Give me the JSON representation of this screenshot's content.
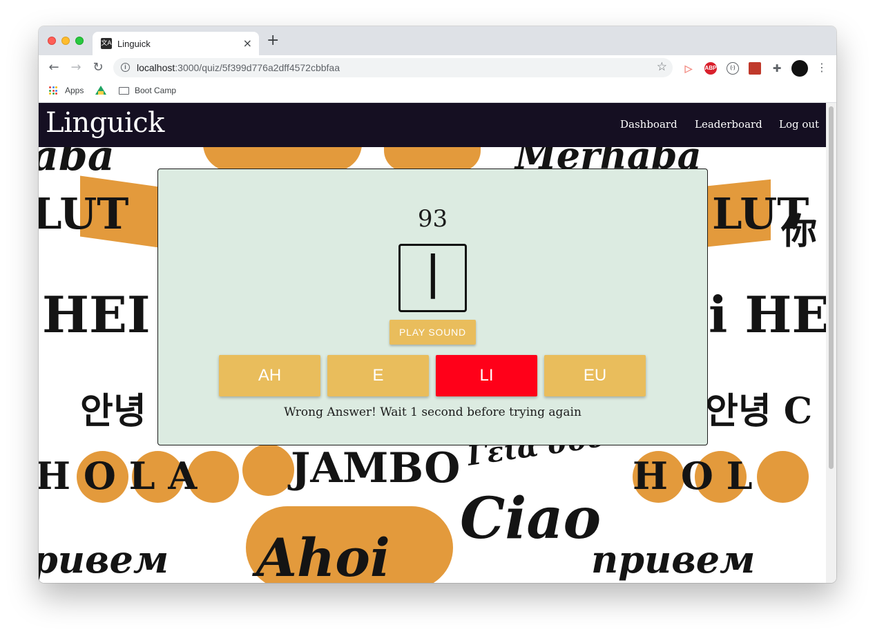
{
  "browser": {
    "tab_title": "Linguick",
    "tab_favicon": "文A",
    "new_tab_label": "+",
    "url_host": "localhost",
    "url_rest": ":3000/quiz/5f399d776a2dff4572cbbfaa",
    "bookmarks": [
      {
        "label": "Apps",
        "icon": "apps-grid-icon"
      },
      {
        "label": "",
        "icon": "google-drive-icon"
      },
      {
        "label": "Boot Camp",
        "icon": "folder-icon"
      }
    ],
    "extensions": [
      {
        "name": "cast-icon",
        "text": "",
        "color": "#f28b82"
      },
      {
        "name": "adblock-plus-icon",
        "text": "ABP",
        "color": "#d9202c"
      },
      {
        "name": "code-extension-icon",
        "text": "(·)",
        "color": "#5f6368"
      },
      {
        "name": "image-extension-icon",
        "text": "",
        "color": "#c0392b"
      },
      {
        "name": "puzzle-extensions-icon",
        "text": "",
        "color": "#5f6368"
      },
      {
        "name": "profile-avatar",
        "text": "",
        "color": "#111111"
      }
    ]
  },
  "app": {
    "brand": "Linguick",
    "nav": {
      "dashboard": "Dashboard",
      "leaderboard": "Leaderboard",
      "logout": "Log out"
    },
    "colors": {
      "navbar": "#150f22",
      "card": "#dcebe1",
      "answer": "#e9bd5c",
      "wrong": "#ff0019"
    }
  },
  "quiz": {
    "timer": "93",
    "character": "ㅣ",
    "play_sound": "PLAY SOUND",
    "answers": [
      "AH",
      "E",
      "LI",
      "EU"
    ],
    "selected_wrong_index": 2,
    "message": "Wrong Answer! Wait 1 second before trying again"
  },
  "wallpaper_words": [
    "aba",
    "Merhaba",
    "LUT",
    "LUT",
    "你",
    "HEI HE",
    "i HEI",
    "안녕",
    "안녕 C",
    "H O L A",
    "JAMBO",
    "Γεια σου",
    "Ciao",
    "H O L",
    "ривем",
    "Ahoi",
    "привем"
  ]
}
